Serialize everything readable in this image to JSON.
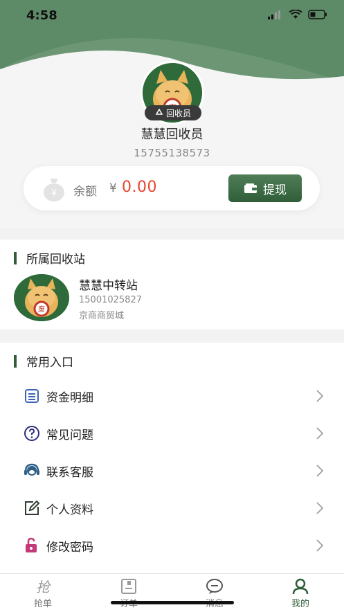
{
  "status_bar": {
    "time": "4:58"
  },
  "profile": {
    "name": "慧慧回收员",
    "phone": "15755138573",
    "role_badge": "回收员"
  },
  "balance": {
    "label": "余额",
    "currency": "¥",
    "value": "0.00",
    "withdraw_label": "提现"
  },
  "station": {
    "section_title": "所属回收站",
    "name": "慧慧中转站",
    "phone": "15001025827",
    "address": "京商商贸城"
  },
  "entries": {
    "section_title": "常用入口",
    "items": [
      {
        "label": "资金明细",
        "icon": "list-icon"
      },
      {
        "label": "常见问题",
        "icon": "question-icon"
      },
      {
        "label": "联系客服",
        "icon": "headset-icon"
      },
      {
        "label": "个人资料",
        "icon": "edit-icon"
      },
      {
        "label": "修改密码",
        "icon": "lock-icon"
      }
    ]
  },
  "tabbar": {
    "tabs": [
      {
        "label": "抢单",
        "icon": "grab-order-icon",
        "active": false
      },
      {
        "label": "订单",
        "icon": "order-icon",
        "active": false
      },
      {
        "label": "消息",
        "icon": "message-icon",
        "active": false
      },
      {
        "label": "我的",
        "icon": "person-icon",
        "active": true
      }
    ]
  },
  "colors": {
    "brand_green": "#2f5e39",
    "header_green": "#5d8a66",
    "balance_red": "#e8442f",
    "active_tab": "#2f5e39"
  }
}
